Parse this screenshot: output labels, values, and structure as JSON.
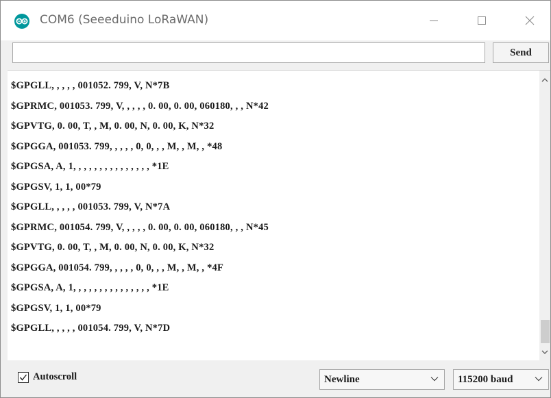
{
  "window": {
    "title": "COM6 (Seeeduino LoRaWAN)",
    "minimize_glyph": "—",
    "maximize_glyph": "☐",
    "close_glyph": "✕"
  },
  "send": {
    "input_value": "",
    "button_label": "Send"
  },
  "output": {
    "lines": [
      "$GPGLL, , , , , 001052. 799, V, N*7B",
      "$GPRMC, 001053. 799, V, , , , , 0. 00, 0. 00, 060180, , , N*42",
      "$GPVTG, 0. 00, T, , M, 0. 00, N, 0. 00, K, N*32",
      "$GPGGA, 001053. 799, , , , , 0, 0, , , M, , M, , *48",
      "$GPGSA, A, 1, , , , , , , , , , , , , , , *1E",
      "$GPGSV, 1, 1, 00*79",
      "$GPGLL, , , , , 001053. 799, V, N*7A",
      "$GPRMC, 001054. 799, V, , , , , 0. 00, 0. 00, 060180, , , N*45",
      "$GPVTG, 0. 00, T, , M, 0. 00, N, 0. 00, K, N*32",
      "$GPGGA, 001054. 799, , , , , 0, 0, , , M, , M, , *4F",
      "$GPGSA, A, 1, , , , , , , , , , , , , , , *1E",
      "$GPGSV, 1, 1, 00*79",
      "$GPGLL, , , , , 001054. 799, V, N*7D"
    ]
  },
  "footer": {
    "autoscroll_label": "Autoscroll",
    "autoscroll_checked": true,
    "line_ending": "Newline",
    "baud_rate": "115200 baud"
  },
  "colors": {
    "accent": "#00979c",
    "window_bg": "#f0f0f0",
    "output_bg": "#ffffff"
  }
}
